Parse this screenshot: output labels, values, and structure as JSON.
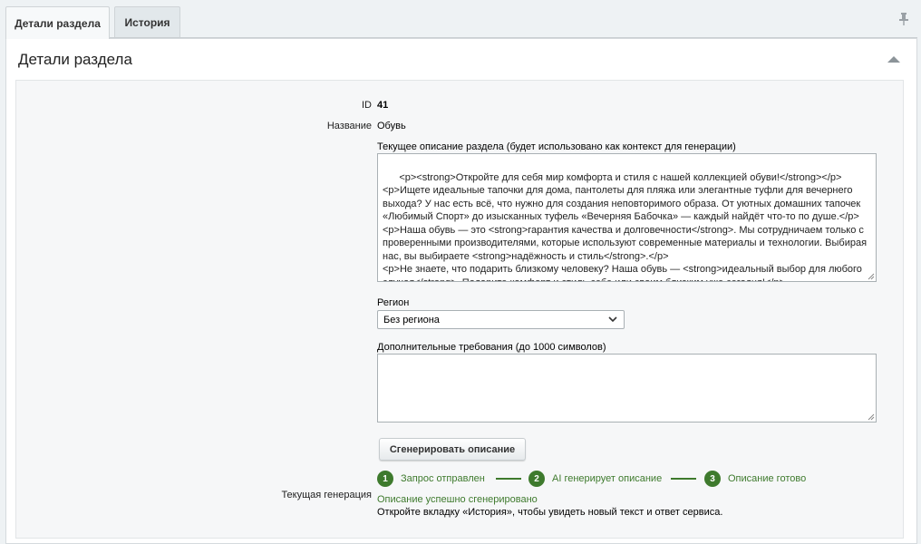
{
  "tabs": [
    {
      "label": "Детали раздела",
      "active": true
    },
    {
      "label": "История",
      "active": false
    }
  ],
  "panel": {
    "title": "Детали раздела"
  },
  "fields": {
    "id_label": "ID",
    "id_value": "41",
    "name_label": "Название",
    "name_value": "Обувь",
    "current_desc_label": "Текущее описание раздела (будет использовано как контекст для генерации)",
    "current_desc_value": "<p><strong>Откройте для себя мир комфорта и стиля с нашей коллекцией обуви!</strong></p>\n<p>Ищете идеальные тапочки для дома, пантолеты для пляжа или элегантные туфли для вечернего выхода? У нас есть всё, что нужно для создания неповторимого образа. От уютных домашних тапочек «Любимый Спорт» до изысканных туфель «Вечерняя Бабочка» — каждый найдёт что-то по душе.</p>\n<p>Наша обувь — это <strong>гарантия качества и долговечности</strong>. Мы сотрудничаем только с проверенными производителями, которые используют современные материалы и технологии. Выбирая нас, вы выбираете <strong>надёжность и стиль</strong>.</p>\n<p>Не знаете, что подарить близкому человеку? Наша обувь — <strong>идеальный выбор для любого случая</strong>. Подарите комфорт и стиль себе или своим близким уже сегодня!</p>",
    "region_label": "Регион",
    "region_value": "Без региона",
    "extra_label": "Дополнительные требования (до 1000 символов)",
    "extra_value": ""
  },
  "generate_button": "Сгенерировать описание",
  "generation": {
    "label": "Текущая генерация",
    "steps": [
      {
        "num": "1",
        "label": "Запрос отправлен"
      },
      {
        "num": "2",
        "label": "AI генерирует описание"
      },
      {
        "num": "3",
        "label": "Описание готово"
      }
    ],
    "success": "Описание успешно сгенерировано",
    "hint": "Откройте вкладку «История», чтобы увидеть новый текст и ответ сервиса."
  },
  "colors": {
    "accent_green": "#3e7a2d",
    "panel_bg": "#eef2f4"
  },
  "icons": {
    "pin": "pin-icon",
    "collapse": "collapse-arrow-icon",
    "select": "chevron-down-icon"
  }
}
